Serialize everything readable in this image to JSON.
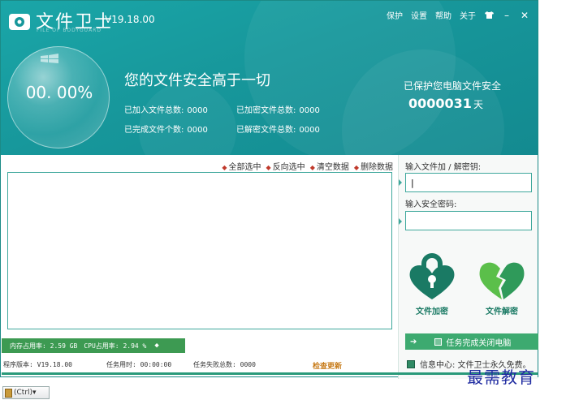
{
  "app": {
    "title": "文件卫士",
    "subtitle": "FILE OF BODYGUARD",
    "version": "V19.18.00"
  },
  "top_menu": {
    "protect": "保护",
    "settings": "设置",
    "help": "帮助",
    "about": "关于",
    "shirt_icon": "♥",
    "minimize": "–",
    "close": "✕"
  },
  "header": {
    "percent": "00. 00%",
    "slogan": "您的文件安全高于一切",
    "stats": {
      "added_label": "已加入文件总数:",
      "added_value": "0000",
      "encrypted_label": "已加密文件总数:",
      "encrypted_value": "0000",
      "completed_label": "已完成文件个数:",
      "completed_value": "0000",
      "decrypted_label": "已解密文件总数:",
      "decrypted_value": "0000"
    },
    "protect_label": "已保护您电脑文件安全",
    "protect_days": "0000031",
    "protect_unit": "天"
  },
  "actions": {
    "select_all": "全部选中",
    "invert": "反向选中",
    "clear": "清空数据",
    "delete": "删除数据"
  },
  "right_panel": {
    "key_label": "输入文件加 / 解密钥:",
    "key_value": "|",
    "pwd_label": "输入安全密码:",
    "pwd_value": "",
    "encrypt_label": "文件加密",
    "decrypt_label": "文件解密",
    "auto_shutdown": "任务完成关闭电脑",
    "info_center": "信息中心: 文件卫士永久免费。"
  },
  "status": {
    "memory": "内存占用率: 2.59 GB",
    "cpu": "CPU占用率: 2.94 %",
    "version_label": "程序版本: V19.18.00",
    "task_time": "任务用时:  00:00:00",
    "task_fail": "任务失败总数: 0000",
    "check_update": "检查更新"
  },
  "watermark": "最需教育",
  "taskbar": {
    "paste_label": "(Ctrl)▾"
  },
  "colors": {
    "header": "#17979b",
    "accent_green": "#3d9a52",
    "lock_dark": "#1a7a64",
    "lock_light": "#5bbf4a",
    "update_orange": "#c77b19"
  }
}
